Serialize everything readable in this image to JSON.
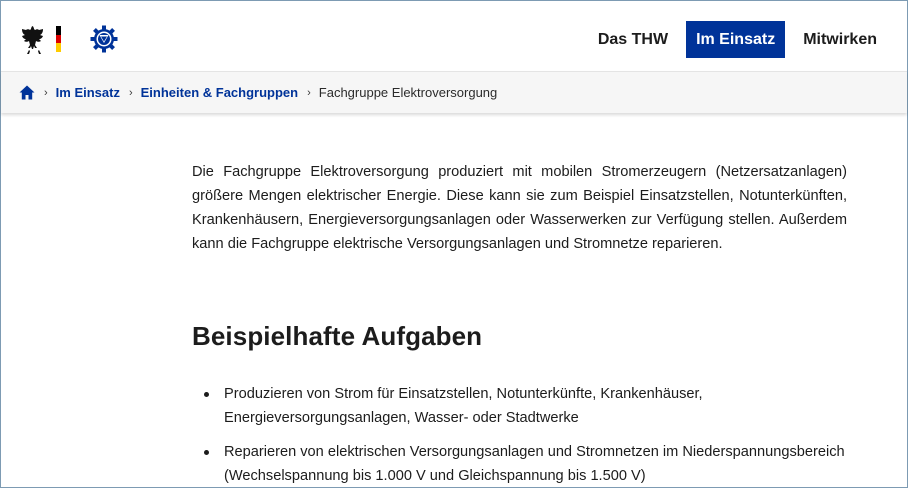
{
  "header": {
    "nav": [
      {
        "label": "Das THW",
        "active": false
      },
      {
        "label": "Im Einsatz",
        "active": true
      },
      {
        "label": "Mitwirken",
        "active": false
      }
    ],
    "flag_colors": [
      "#000000",
      "#dd0000",
      "#ffcc00"
    ],
    "accent": "#003399"
  },
  "breadcrumb": {
    "home_icon": "home-icon",
    "items": [
      "Im Einsatz",
      "Einheiten & Fachgruppen"
    ],
    "current": "Fachgruppe Elektroversorgung"
  },
  "main": {
    "intro": "Die Fachgruppe Elektroversorgung produziert mit mobilen Stromerzeugern (Netzersatzanlagen) größere Mengen elektrischer Energie. Diese kann sie zum Beispiel Einsatzstellen, Notunterkünften, Krankenhäusern, Energieversorgungsanlagen oder Wasserwerken zur Verfügung stellen. Außerdem kann die Fachgruppe elektrische Versorgungsanlagen und Stromnetze reparieren.",
    "section_title": "Beispielhafte Aufgaben",
    "tasks": [
      "Produzieren von Strom für Einsatzstellen, Notunterkünfte, Krankenhäuser, Energieversorgungsanlagen, Wasser- oder Stadtwerke",
      "Reparieren von elektrischen Versorgungsanlagen und Stromnetzen im Niederspannungsbereich (Wechselspannung bis 1.000 V und Gleichspannung bis 1.500 V)"
    ]
  }
}
